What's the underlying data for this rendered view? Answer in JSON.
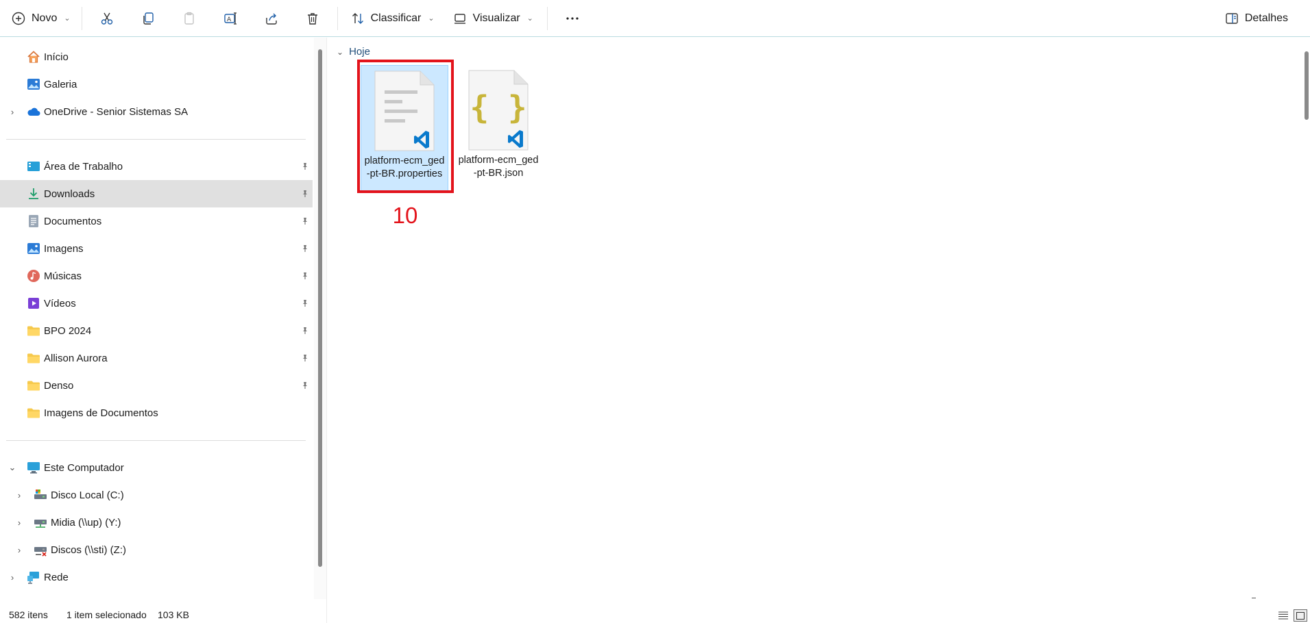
{
  "toolbar": {
    "new_label": "Novo",
    "sort_label": "Classificar",
    "view_label": "Visualizar",
    "details_label": "Detalhes",
    "icons": [
      "plus-circle-icon",
      "scissors-icon",
      "copy-icon",
      "paste-icon",
      "rename-icon",
      "share-icon",
      "trash-icon",
      "sort-icon",
      "view-icon",
      "more-icon",
      "details-pane-icon"
    ]
  },
  "sidebar": {
    "top_items": [
      {
        "label": "Início",
        "icon": "home-icon"
      },
      {
        "label": "Galeria",
        "icon": "gallery-icon"
      },
      {
        "label": "OneDrive - Senior Sistemas SA",
        "icon": "cloud-icon",
        "expandable": true
      }
    ],
    "quick_access": [
      {
        "label": "Área de Trabalho",
        "icon": "desktop-icon",
        "pinned": true
      },
      {
        "label": "Downloads",
        "icon": "download-icon",
        "pinned": true,
        "selected": true
      },
      {
        "label": "Documentos",
        "icon": "documents-icon",
        "pinned": true
      },
      {
        "label": "Imagens",
        "icon": "pictures-icon",
        "pinned": true
      },
      {
        "label": "Músicas",
        "icon": "music-icon",
        "pinned": true
      },
      {
        "label": "Vídeos",
        "icon": "videos-icon",
        "pinned": true
      },
      {
        "label": "BPO 2024",
        "icon": "folder-icon",
        "pinned": true
      },
      {
        "label": "Allison Aurora",
        "icon": "folder-icon",
        "pinned": true
      },
      {
        "label": "Denso",
        "icon": "folder-icon",
        "pinned": true
      },
      {
        "label": "Imagens de Documentos",
        "icon": "folder-icon",
        "pinned": false
      }
    ],
    "computer": {
      "label": "Este Computador",
      "drives": [
        {
          "label": "Disco Local (C:)",
          "icon": "local-disk-icon"
        },
        {
          "label": "Midia (\\\\up) (Y:)",
          "icon": "network-drive-icon"
        },
        {
          "label": "Discos (\\\\sti) (Z:)",
          "icon": "disconnected-drive-icon"
        }
      ]
    },
    "network_label": "Rede"
  },
  "content": {
    "group_label": "Hoje",
    "files": [
      {
        "name": "platform-ecm_ged-pt-BR.properties",
        "type": "properties",
        "selected": true
      },
      {
        "name": "platform-ecm_ged-pt-BR.json",
        "type": "json",
        "selected": false
      }
    ],
    "annotation_number": "10"
  },
  "status": {
    "item_count": "582 itens",
    "selection": "1 item selecionado",
    "size": "103 KB"
  },
  "colors": {
    "selection_bg": "#cce8ff",
    "highlight_red": "#e3131b",
    "folder_yellow": "#f6c94c",
    "vscode_blue": "#0a7acc"
  }
}
